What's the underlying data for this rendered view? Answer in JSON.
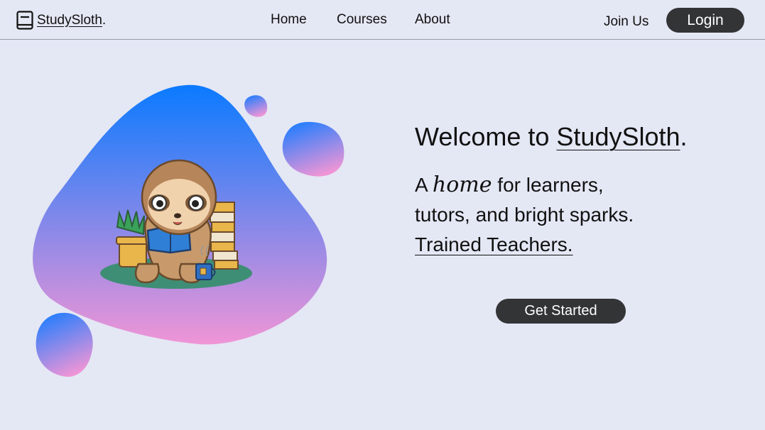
{
  "nav": {
    "logo_prefix": "StudySloth",
    "logo_suffix": ".",
    "links": [
      "Home",
      "Courses",
      "About"
    ],
    "join_label": "Join Us",
    "login_label": "Login"
  },
  "hero": {
    "headline_prefix": "Welcome to ",
    "headline_brand": "StudySloth",
    "headline_suffix": ".",
    "tagline_a": "A",
    "tagline_script": "home",
    "tagline_rest": " for learners,",
    "tagline_line2": "tutors, and bright sparks.",
    "tagline_line3": "Trained Teachers.",
    "cta_label": "Get Started"
  },
  "colors": {
    "background": "#e4e7f4",
    "button": "#333436",
    "blob_top": "#0a7aff",
    "blob_bottom": "#f095d6"
  }
}
